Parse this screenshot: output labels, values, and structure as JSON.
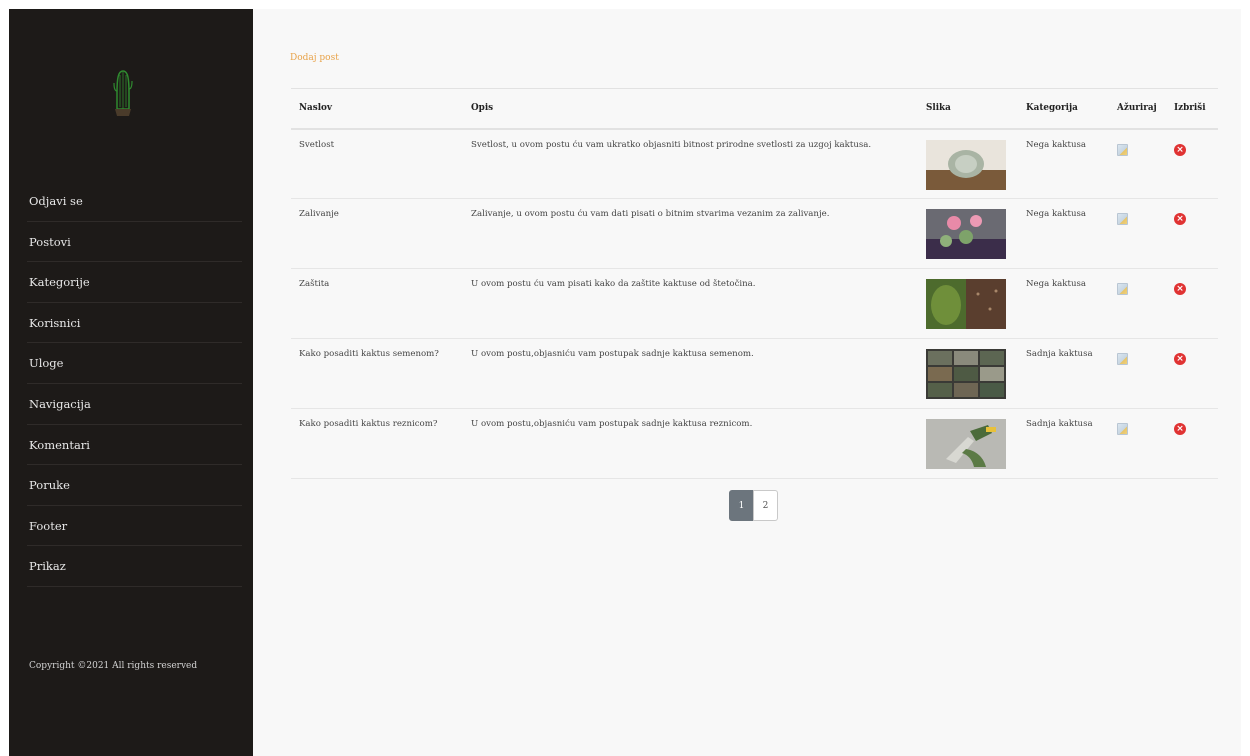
{
  "sidebar": {
    "logo_icon": "cactus-icon",
    "items": [
      {
        "label": "Odjavi se"
      },
      {
        "label": "Postovi"
      },
      {
        "label": "Kategorije"
      },
      {
        "label": "Korisnici"
      },
      {
        "label": "Uloge"
      },
      {
        "label": "Navigacija"
      },
      {
        "label": "Komentari"
      },
      {
        "label": "Poruke"
      },
      {
        "label": "Footer"
      },
      {
        "label": "Prikaz"
      }
    ],
    "copyright": "Copyright ©2021 All rights reserved"
  },
  "main": {
    "add_post": "Dodaj post",
    "columns": {
      "title": "Naslov",
      "description": "Opis",
      "image": "Slika",
      "category": "Kategorija",
      "update": "Ažuriraj",
      "delete": "Izbriši"
    },
    "rows": [
      {
        "title": "Svetlost",
        "description": "Svetlost, u ovom postu ću vam ukratko objasniti bitnost prirodne svetlosti za uzgoj kaktusa.",
        "category": "Nega kaktusa"
      },
      {
        "title": "Zalivanje",
        "description": "Zalivanje, u ovom postu ću vam dati pisati o bitnim stvarima vezanim za zalivanje.",
        "category": "Nega kaktusa"
      },
      {
        "title": "Zaštita",
        "description": "U ovom postu ću vam pisati kako da zaštite kaktuse od štetočina.",
        "category": "Nega kaktusa"
      },
      {
        "title": "Kako posaditi kaktus semenom?",
        "description": "U ovom postu,objasniću vam postupak sadnje kaktusa semenom.",
        "category": "Sadnja kaktusa"
      },
      {
        "title": "Kako posaditi kaktus reznicom?",
        "description": "U ovom postu,objasniću vam postupak sadnje kaktusa reznicom.",
        "category": "Sadnja kaktusa"
      }
    ],
    "pagination": {
      "pages": [
        "1",
        "2"
      ],
      "current": "1"
    },
    "colors": {
      "sidebar_bg": "#1d1a18",
      "accent": "#e8a34a",
      "delete": "#e03333",
      "pager_active": "#6c757d"
    }
  }
}
